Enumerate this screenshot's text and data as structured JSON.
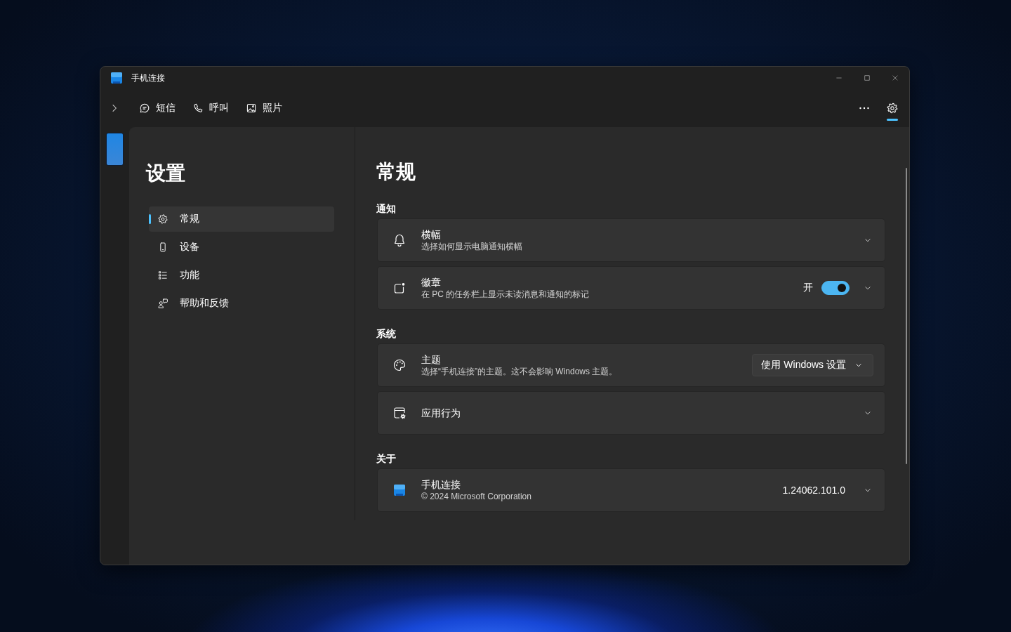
{
  "window": {
    "title": "手机连接"
  },
  "nav": {
    "tabs": [
      {
        "label": "短信",
        "selected": false
      },
      {
        "label": "呼叫",
        "selected": false
      },
      {
        "label": "照片",
        "selected": false
      }
    ],
    "settings": {
      "selected": true
    }
  },
  "sidebar": {
    "title": "设置",
    "items": [
      {
        "label": "常规",
        "selected": true
      },
      {
        "label": "设备",
        "selected": false
      },
      {
        "label": "功能",
        "selected": false
      },
      {
        "label": "帮助和反馈",
        "selected": false
      }
    ]
  },
  "content": {
    "title": "常规",
    "sections": [
      {
        "heading": "通知",
        "cards": [
          {
            "kind": "expander",
            "title": "横幅",
            "subtitle": "选择如何显示电脑通知横幅"
          },
          {
            "kind": "toggle",
            "title": "徽章",
            "subtitle": "在 PC 的任务栏上显示未读消息和通知的标记",
            "toggle_label": "开",
            "on": true
          }
        ]
      },
      {
        "heading": "系统",
        "cards": [
          {
            "kind": "dropdown",
            "title": "主题",
            "subtitle": "选择“手机连接”的主题。这不会影响 Windows 主题。",
            "value": "使用 Windows 设置"
          },
          {
            "kind": "expander",
            "title": "应用行为"
          }
        ]
      },
      {
        "heading": "关于",
        "cards": [
          {
            "kind": "about",
            "title": "手机连接",
            "subtitle": "© 2024 Microsoft Corporation",
            "version": "1.24062.101.0"
          }
        ]
      }
    ]
  }
}
